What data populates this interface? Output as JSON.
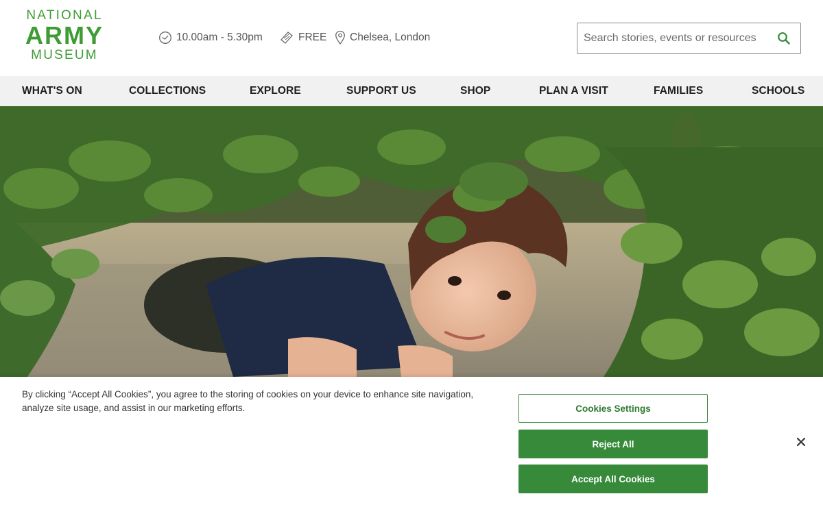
{
  "logo": {
    "line1": "NATIONAL",
    "line2": "ARMY",
    "line3": "MUSEUM",
    "color": "#3f9c35"
  },
  "info": {
    "hours": "10.00am - 5.30pm",
    "price": "FREE",
    "location": "Chelsea, London"
  },
  "search": {
    "placeholder": "Search stories, events or resources",
    "icon": "search-icon"
  },
  "nav": {
    "items": [
      {
        "label": "WHAT'S ON"
      },
      {
        "label": "COLLECTIONS"
      },
      {
        "label": "EXPLORE"
      },
      {
        "label": "SUPPORT US"
      },
      {
        "label": "SHOP"
      },
      {
        "label": "PLAN A VISIT"
      },
      {
        "label": "FAMILIES"
      },
      {
        "label": "SCHOOLS"
      }
    ]
  },
  "hero": {
    "image": "boy-crawling-under-camouflage-net"
  },
  "cookie": {
    "text": "By clicking “Accept All Cookies”, you agree to the storing of cookies on your device to enhance site navigation, analyze site usage, and assist in our marketing efforts.",
    "settings_label": "Cookies Settings",
    "reject_label": "Reject All",
    "accept_label": "Accept All Cookies",
    "accent": "#368a3a"
  }
}
